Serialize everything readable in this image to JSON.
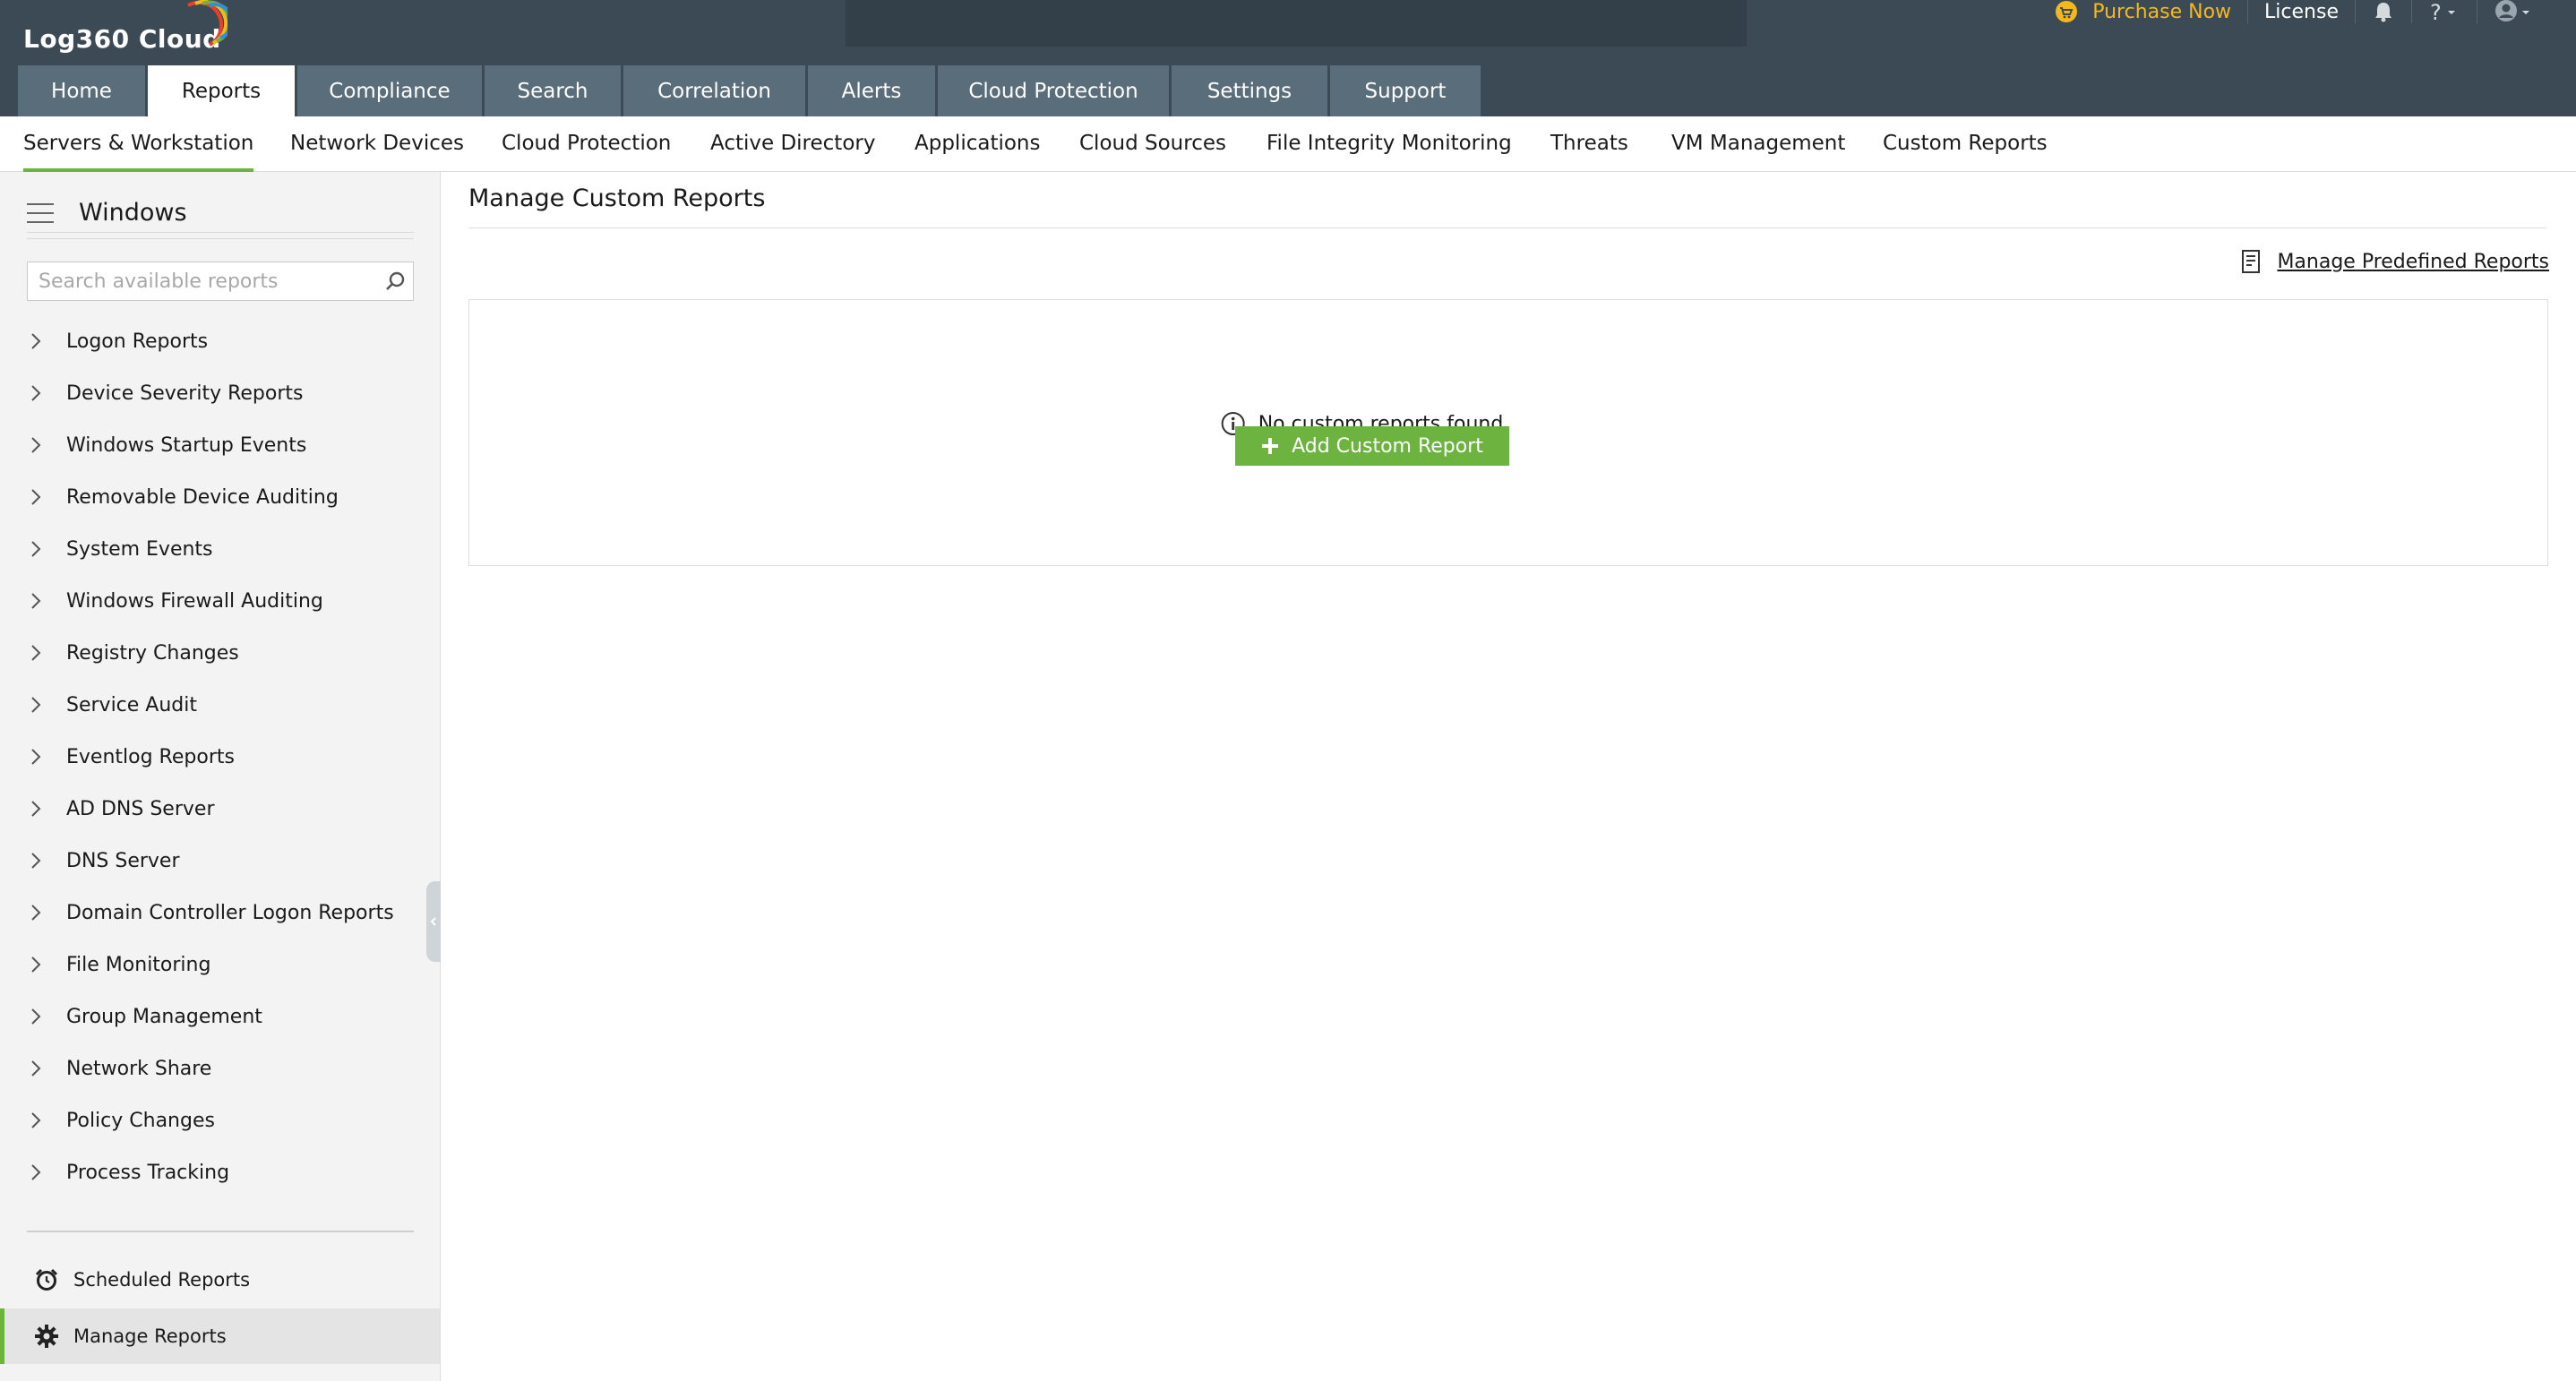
{
  "app": {
    "logo_text": "Log360 Cloud",
    "accent_color": "#6cb33f",
    "header_color": "#3b4a55"
  },
  "top_right": {
    "purchase_label": "Purchase Now",
    "license_label": "License",
    "icons": [
      "cart-icon",
      "bell-icon",
      "help-icon",
      "user-icon"
    ]
  },
  "main_tabs": [
    {
      "label": "Home"
    },
    {
      "label": "Reports",
      "active": true
    },
    {
      "label": "Compliance"
    },
    {
      "label": "Search"
    },
    {
      "label": "Correlation"
    },
    {
      "label": "Alerts"
    },
    {
      "label": "Cloud Protection"
    },
    {
      "label": "Settings"
    },
    {
      "label": "Support"
    }
  ],
  "sub_nav": [
    {
      "label": "Servers & Workstation",
      "active": true
    },
    {
      "label": "Network Devices"
    },
    {
      "label": "Cloud Protection"
    },
    {
      "label": "Active Directory"
    },
    {
      "label": "Applications"
    },
    {
      "label": "Cloud Sources"
    },
    {
      "label": "File Integrity Monitoring"
    },
    {
      "label": "Threats"
    },
    {
      "label": "VM Management"
    },
    {
      "label": "Custom Reports"
    }
  ],
  "sidebar": {
    "title": "Windows",
    "search_placeholder": "Search available reports",
    "items": [
      {
        "label": "Logon Reports"
      },
      {
        "label": "Device Severity Reports"
      },
      {
        "label": "Windows Startup Events"
      },
      {
        "label": "Removable Device Auditing"
      },
      {
        "label": "System Events"
      },
      {
        "label": "Windows Firewall Auditing"
      },
      {
        "label": "Registry Changes"
      },
      {
        "label": "Service Audit"
      },
      {
        "label": "Eventlog Reports"
      },
      {
        "label": "AD DNS Server"
      },
      {
        "label": "DNS Server"
      },
      {
        "label": "Domain Controller Logon Reports"
      },
      {
        "label": "File Monitoring"
      },
      {
        "label": "Group Management"
      },
      {
        "label": "Network Share"
      },
      {
        "label": "Policy Changes"
      },
      {
        "label": "Process Tracking"
      }
    ],
    "scheduled_label": "Scheduled Reports",
    "manage_label": "Manage Reports"
  },
  "main": {
    "title": "Manage Custom Reports",
    "predefined_link": "Manage Predefined Reports",
    "empty_message": "No custom reports found.",
    "add_button": "Add Custom Report"
  }
}
